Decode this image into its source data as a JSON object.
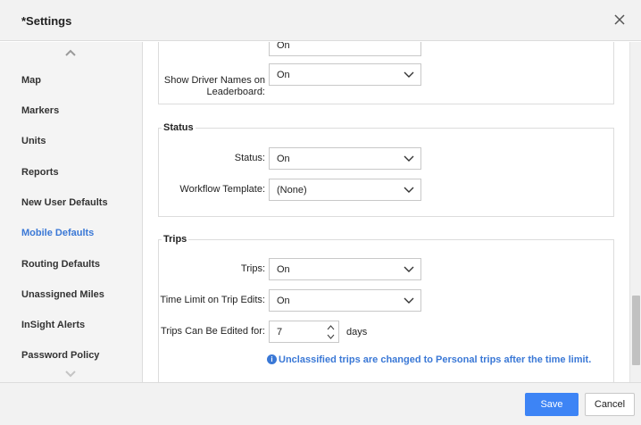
{
  "window": {
    "title": "*Settings"
  },
  "sidebar": {
    "items": [
      {
        "label": "Map"
      },
      {
        "label": "Markers"
      },
      {
        "label": "Units"
      },
      {
        "label": "Reports"
      },
      {
        "label": "New User Defaults"
      },
      {
        "label": "Mobile Defaults",
        "active": true
      },
      {
        "label": "Routing Defaults"
      },
      {
        "label": "Unassigned Miles"
      },
      {
        "label": "InSight Alerts"
      },
      {
        "label": "Password Policy"
      }
    ]
  },
  "sections": {
    "leaderboard": {
      "partial_value": "On",
      "driver_names_label": "Show Driver Names on Leaderboard:",
      "driver_names_value": "On"
    },
    "status": {
      "title": "Status",
      "status_label": "Status:",
      "status_value": "On",
      "workflow_label": "Workflow Template:",
      "workflow_value": "(None)"
    },
    "trips": {
      "title": "Trips",
      "trips_label": "Trips:",
      "trips_value": "On",
      "time_limit_label": "Time Limit on Trip Edits:",
      "time_limit_value": "On",
      "edit_days_label": "Trips Can Be Edited for:",
      "edit_days_value": "7",
      "days_unit": "days",
      "info_text": "Unclassified trips are changed to Personal trips after the time limit."
    }
  },
  "footer": {
    "save_label": "Save",
    "cancel_label": "Cancel"
  },
  "colors": {
    "accent": "#3d84f5",
    "active_nav": "#3a78d6",
    "header_bg": "#f2f2f2"
  },
  "icons": {
    "close": "close-icon",
    "scroll_up": "chevron-up-icon",
    "scroll_down": "chevron-down-icon",
    "dropdown": "chevron-down-icon",
    "info": "info-icon"
  }
}
